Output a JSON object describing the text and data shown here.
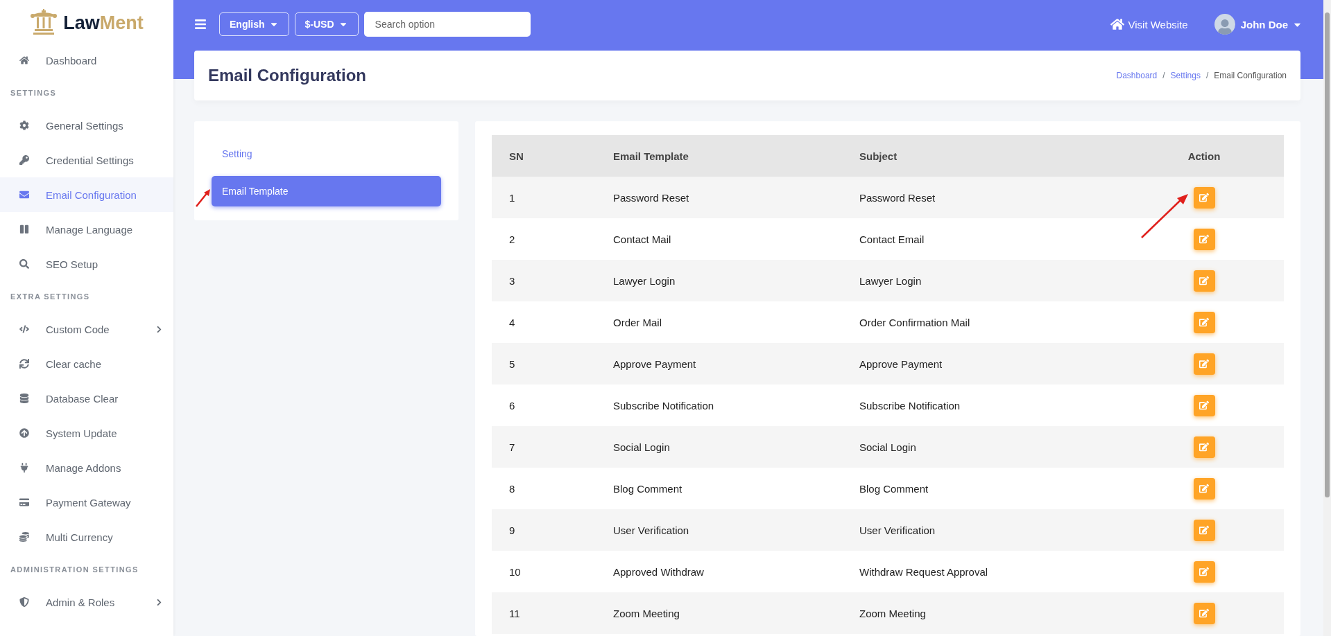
{
  "logo": {
    "part_1": "Law",
    "part_2": "Ment"
  },
  "sidebar": {
    "sections": [
      {
        "items": [
          {
            "label": "Dashboard",
            "selected": false,
            "expandable": false
          }
        ]
      },
      {
        "heading": "SETTINGS",
        "items": [
          {
            "label": "General Settings",
            "selected": false,
            "expandable": false
          },
          {
            "label": "Credential Settings",
            "selected": false,
            "expandable": false
          },
          {
            "label": "Email Configuration",
            "selected": true,
            "expandable": false
          },
          {
            "label": "Manage Language",
            "selected": false,
            "expandable": false
          },
          {
            "label": "SEO Setup",
            "selected": false,
            "expandable": false
          }
        ]
      },
      {
        "heading": "EXTRA SETTINGS",
        "items": [
          {
            "label": "Custom Code",
            "selected": false,
            "expandable": true
          },
          {
            "label": "Clear cache",
            "selected": false,
            "expandable": false
          },
          {
            "label": "Database Clear",
            "selected": false,
            "expandable": false
          },
          {
            "label": "System Update",
            "selected": false,
            "expandable": false
          },
          {
            "label": "Manage Addons",
            "selected": false,
            "expandable": false
          },
          {
            "label": "Payment Gateway",
            "selected": false,
            "expandable": false
          },
          {
            "label": "Multi Currency",
            "selected": false,
            "expandable": false
          }
        ]
      },
      {
        "heading": "ADMINISTRATION SETTINGS",
        "items": [
          {
            "label": "Admin & Roles",
            "selected": false,
            "expandable": true
          }
        ]
      }
    ]
  },
  "topbar": {
    "language": "English",
    "currency": "$-USD",
    "search": {
      "placeholder": "Search option"
    },
    "visit_website": "Visit Website",
    "user": "John Doe"
  },
  "page": {
    "title": "Email Configuration",
    "breadcrumb": [
      {
        "label": "Dashboard",
        "link": true
      },
      {
        "separator": "/",
        "label": "Settings",
        "link": true
      },
      {
        "separator": "/",
        "label": "Email Configuration",
        "link": false
      }
    ]
  },
  "tabs": [
    {
      "label": "Setting",
      "selected": false
    },
    {
      "label": "Email Template",
      "selected": true
    }
  ],
  "table": {
    "columns": [
      "SN",
      "Email Template",
      "Subject",
      "Action"
    ],
    "rows": [
      {
        "sn": "1",
        "template": "Password Reset",
        "subject": "Password Reset"
      },
      {
        "sn": "2",
        "template": "Contact Mail",
        "subject": "Contact Email"
      },
      {
        "sn": "3",
        "template": "Lawyer Login",
        "subject": "Lawyer Login"
      },
      {
        "sn": "4",
        "template": "Order Mail",
        "subject": "Order Confirmation Mail"
      },
      {
        "sn": "5",
        "template": "Approve Payment",
        "subject": "Approve Payment"
      },
      {
        "sn": "6",
        "template": "Subscribe Notification",
        "subject": "Subscribe Notification"
      },
      {
        "sn": "7",
        "template": "Social Login",
        "subject": "Social Login"
      },
      {
        "sn": "8",
        "template": "Blog Comment",
        "subject": "Blog Comment"
      },
      {
        "sn": "9",
        "template": "User Verification",
        "subject": "User Verification"
      },
      {
        "sn": "10",
        "template": "Approved Withdraw",
        "subject": "Withdraw Request Approval"
      },
      {
        "sn": "11",
        "template": "Zoom Meeting",
        "subject": "Zoom Meeting"
      }
    ]
  }
}
